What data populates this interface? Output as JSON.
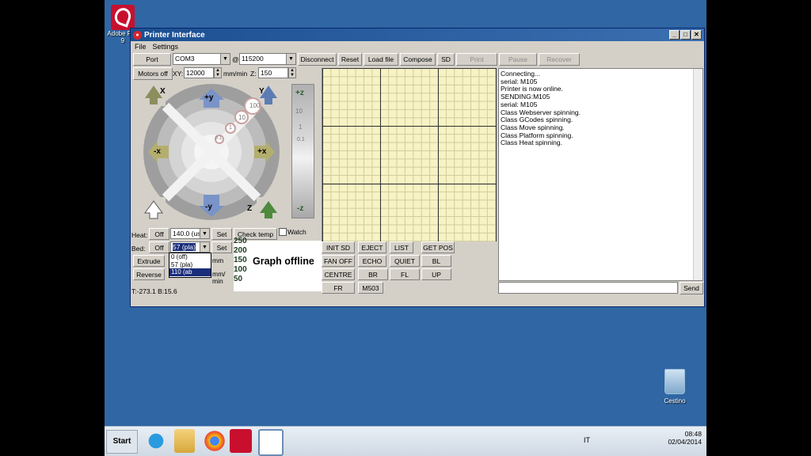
{
  "desktop": {
    "acrobat_label": "Adobe R… 9",
    "recycle_label": "Cestino"
  },
  "window": {
    "title": "Printer Interface",
    "controls": [
      "_",
      "□",
      "✕"
    ]
  },
  "menu": [
    "File",
    "Settings"
  ],
  "toolbar": {
    "port_label": "Port",
    "port_value": "COM3",
    "at_sign": "@",
    "baud_value": "115200",
    "disconnect": "Disconnect",
    "reset": "Reset",
    "load_file": "Load file",
    "compose": "Compose",
    "sd": "SD",
    "print": "Print",
    "pause": "Pause",
    "recover": "Recover"
  },
  "motion": {
    "motors_off": "Motors off",
    "xy_label": "XY:",
    "xy_value": "12000",
    "mm_min": "mm/min",
    "z_label": "Z:",
    "z_value": "150"
  },
  "jog": {
    "home_x": "X",
    "home_y": "Y",
    "home_z": "Z",
    "plus_y": "+y",
    "minus_y": "-y",
    "plus_x": "+x",
    "minus_x": "-x",
    "plus_z": "+z",
    "minus_z": "-z",
    "xy_steps": [
      "100",
      "10",
      "1",
      "0.1"
    ],
    "z_steps": [
      "10",
      "1",
      "0.1"
    ]
  },
  "temps": {
    "heat_label": "Heat:",
    "heat_off": "Off",
    "heat_value": "140.0 (us",
    "set": "Set",
    "check_temp": "Check temp",
    "watch": "Watch",
    "bed_label": "Bed:",
    "bed_off": "Off",
    "bed_value": "57 (pla)",
    "bed_set": "Set",
    "bed_options": [
      "0 (off)",
      "57 (pla)",
      "110 (ab"
    ]
  },
  "extrude": {
    "extrude": "Extrude",
    "reverse": "Reverse",
    "mm": "mm",
    "mm_min": "mm/",
    "min": "min"
  },
  "graph": {
    "offline_text": "Graph offline",
    "ticks": [
      "250",
      "200",
      "150",
      "100",
      "50"
    ]
  },
  "status_text": "T:-273.1 B:15.6",
  "macros": [
    "INIT SD",
    "EJECT",
    "LIST",
    "GET POS",
    "FAN OFF",
    "ECHO",
    "QUIET",
    "BL",
    "CENTRE",
    "BR",
    "FL",
    "UP",
    "FR",
    "M503"
  ],
  "console": {
    "lines": [
      "Connecting...",
      "serial: M105",
      "Printer is now online.",
      "SENDING:M105",
      "serial: M105",
      "Class Webserver spinning.",
      "Class GCodes spinning.",
      "Class Move spinning.",
      "Class Platform spinning.",
      "Class Heat spinning."
    ],
    "send": "Send"
  },
  "taskbar": {
    "start": "Start",
    "lang": "IT",
    "time": "08:48",
    "date": "02/04/2014"
  }
}
